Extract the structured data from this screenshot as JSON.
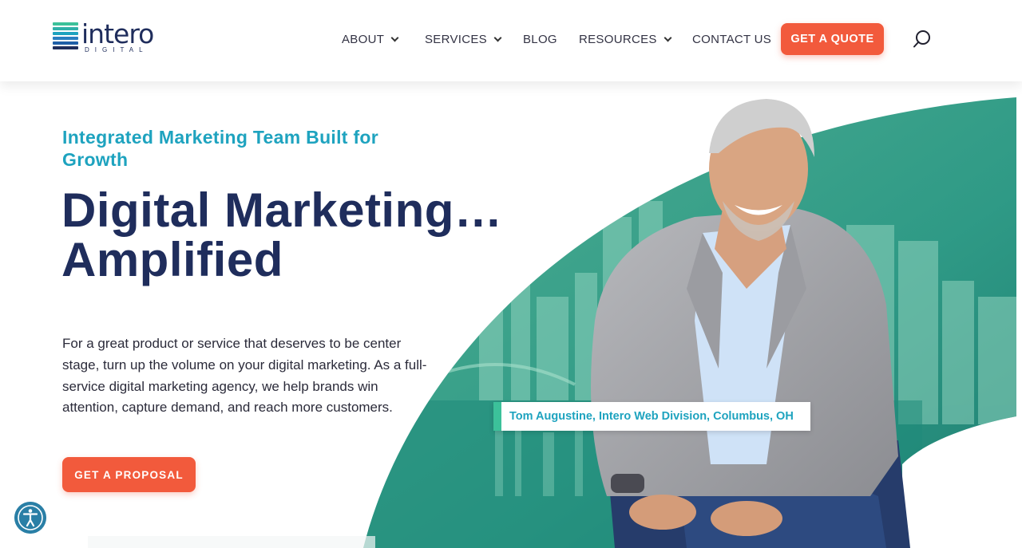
{
  "brand": {
    "name": "intero",
    "sub": "DIGITAL",
    "bar_colors": [
      "#3cc19a",
      "#2fb0a8",
      "#1ea3bf",
      "#2a7fc0",
      "#1f5fa8",
      "#1f2d5c"
    ]
  },
  "nav": {
    "items": [
      {
        "label": "ABOUT",
        "dropdown": true
      },
      {
        "label": "SERVICES",
        "dropdown": true
      },
      {
        "label": "BLOG",
        "dropdown": false
      },
      {
        "label": "RESOURCES",
        "dropdown": true
      },
      {
        "label": "CONTACT US",
        "dropdown": false
      }
    ],
    "quote_label": "GET A QUOTE",
    "search_icon": "search-icon"
  },
  "hero": {
    "eyebrow": "Integrated Marketing Team Built for Growth",
    "headline_line1": "Digital Marketing…",
    "headline_line2": "Amplified",
    "description": "For a great product or service that deserves to be center stage, turn up the volume on your digital marketing. As a full-service digital marketing agency, we help brands win attention, capture demand, and reach more customers.",
    "cta_label": "GET A PROPOSAL",
    "caption": "Tom Augustine, Intero Web Division, Columbus, OH"
  },
  "colors": {
    "accent": "#f25a3c",
    "navy": "#1f2d5c",
    "teal": "#1ea3bf",
    "green": "#3cc19a"
  },
  "accessibility": {
    "icon": "accessibility-icon"
  }
}
